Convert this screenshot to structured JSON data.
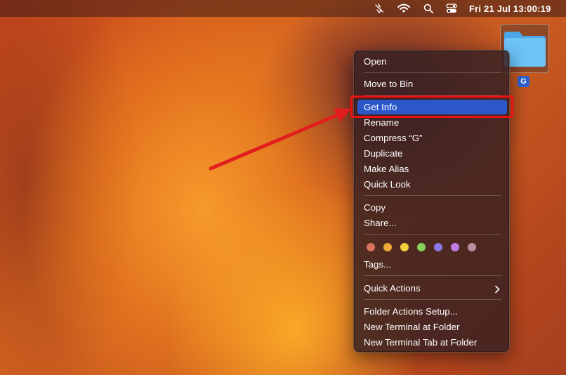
{
  "menubar": {
    "datetime": "Fri 21 Jul  13:00:19",
    "icons": [
      "no-wifi-slash-icon",
      "wifi-icon",
      "search-icon",
      "control-center-icon"
    ]
  },
  "desktop": {
    "folder_label": "G",
    "folder_color": "#5bb8f2"
  },
  "context_menu": {
    "items": {
      "open": "Open",
      "move_to_bin": "Move to Bin",
      "get_info": "Get Info",
      "rename": "Rename",
      "compress": "Compress “G”",
      "duplicate": "Duplicate",
      "make_alias": "Make Alias",
      "quick_look": "Quick Look",
      "copy": "Copy",
      "share": "Share...",
      "tags": "Tags...",
      "quick_actions": "Quick Actions",
      "folder_actions_setup": "Folder Actions Setup...",
      "new_terminal": "New Terminal at Folder",
      "new_terminal_tab": "New Terminal Tab at Folder"
    },
    "highlighted": "Get Info",
    "highlight_color": "#2b57c8",
    "tag_colors": [
      "#d9735e",
      "#eeab3c",
      "#f2d03b",
      "#88d05a",
      "#8a77e8",
      "#c17ae6",
      "#b8909b"
    ],
    "tag_names": [
      "red",
      "orange",
      "yellow",
      "green",
      "blue",
      "purple",
      "grey"
    ]
  },
  "annotation": {
    "color": "#e11d1d"
  }
}
